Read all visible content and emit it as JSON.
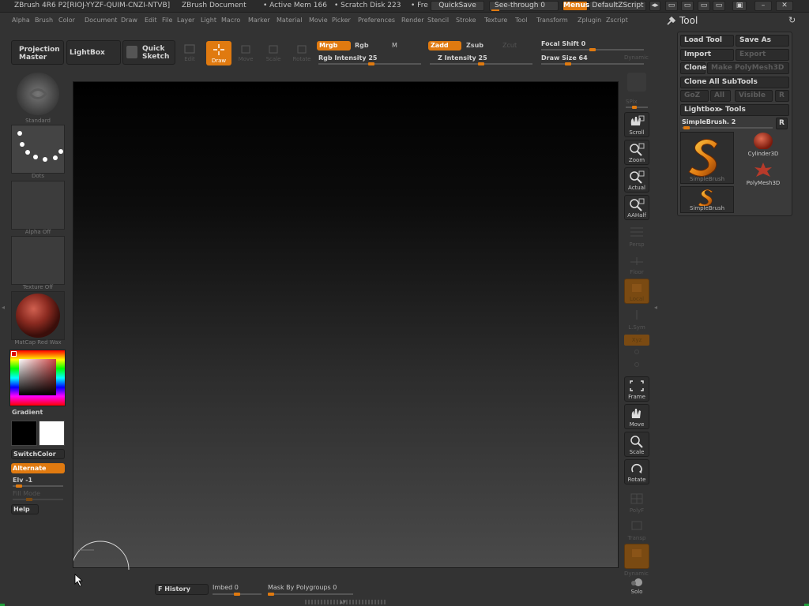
{
  "title_bar": {
    "app": "ZBrush 4R6 P2[RIOJ-YYZF-QUIM-CNZI-NTVB]",
    "document": "ZBrush Document",
    "active_mem": "• Active Mem 166",
    "scratch_disk": "• Scratch Disk 223",
    "free": "• Fre",
    "quicksave": "QuickSave",
    "see_through": "See-through  0",
    "menus": "Menus",
    "default_zscript": "DefaultZScript"
  },
  "menu_bar": [
    "Alpha",
    "Brush",
    "Color",
    "Document",
    "Draw",
    "Edit",
    "File",
    "Layer",
    "Light",
    "Macro",
    "Marker",
    "Material",
    "Movie",
    "Picker",
    "Preferences",
    "Render",
    "Stencil",
    "Stroke",
    "Texture",
    "Tool",
    "Transform",
    "Zplugin",
    "Zscript"
  ],
  "top_shelf": {
    "projection_master": [
      "Projection",
      "Master"
    ],
    "lightbox": "LightBox",
    "quick_sketch": [
      "Quick",
      "Sketch"
    ],
    "edit": "Edit",
    "draw": "Draw",
    "move": "Move",
    "scale": "Scale",
    "rotate": "Rotate",
    "mrgb": "Mrgb",
    "rgb": "Rgb",
    "m": "M",
    "rgb_intensity": "Rgb  Intensity 25",
    "zadd": "Zadd",
    "zsub": "Zsub",
    "zcut": "Zcut",
    "z_intensity": "Z  Intensity 25",
    "focal_shift": "Focal  Shift 0",
    "draw_size": "Draw  Size 64",
    "dynamic": "Dynamic"
  },
  "left_shelf": {
    "standard": "Standard",
    "dots": "Dots",
    "alpha_off": "Alpha  Off",
    "texture_off": "Texture  Off",
    "material": "MatCap  Red  Wax",
    "gradient": "Gradient",
    "switch_color": "SwitchColor",
    "alternate": "Alternate",
    "elv": "Elv -1",
    "fill_mode": "Fill  Mode",
    "help": "Help"
  },
  "right_shelf": {
    "bpr": "BPR",
    "spix": "SPix",
    "scroll": "Scroll",
    "zoom": "Zoom",
    "actual": "Actual",
    "aahalf": "AAHalf",
    "persp": "Persp",
    "floor": "Floor",
    "local": "Local",
    "lsym": "L.Sym",
    "xyz": "Xyz",
    "frame": "Frame",
    "move": "Move",
    "scale": "Scale",
    "rotate": "Rotate",
    "polyf": "PolyF",
    "transp": "Transp",
    "dynamic": "Dynamic",
    "solo": "Solo"
  },
  "tool_panel": {
    "title": "Tool",
    "load_tool": "Load Tool",
    "save_as": "Save As",
    "import": "Import",
    "export": "Export",
    "clone": "Clone",
    "make_polymesh": "Make  PolyMesh3D",
    "clone_all_subtools": "Clone  All SubTools",
    "goz": "GoZ",
    "all": "All",
    "visible": "Visible",
    "r_small": "R",
    "lightbox_tools": "Lightbox▸ Tools",
    "current_tool": "SimpleBrush. 2",
    "r_button": "R",
    "items": [
      "SimpleBrush",
      "Cylinder3D",
      "PolyMesh3D",
      "SimpleBrush"
    ]
  },
  "bottom": {
    "history": "F  History",
    "imbed": "Imbed 0",
    "mask_by_polygroups": "Mask  By  Polygroups 0"
  },
  "colors": {
    "accent": "#e07a10",
    "background": "#333333",
    "primary_color": "#000000",
    "secondary_color": "#ffffff"
  }
}
